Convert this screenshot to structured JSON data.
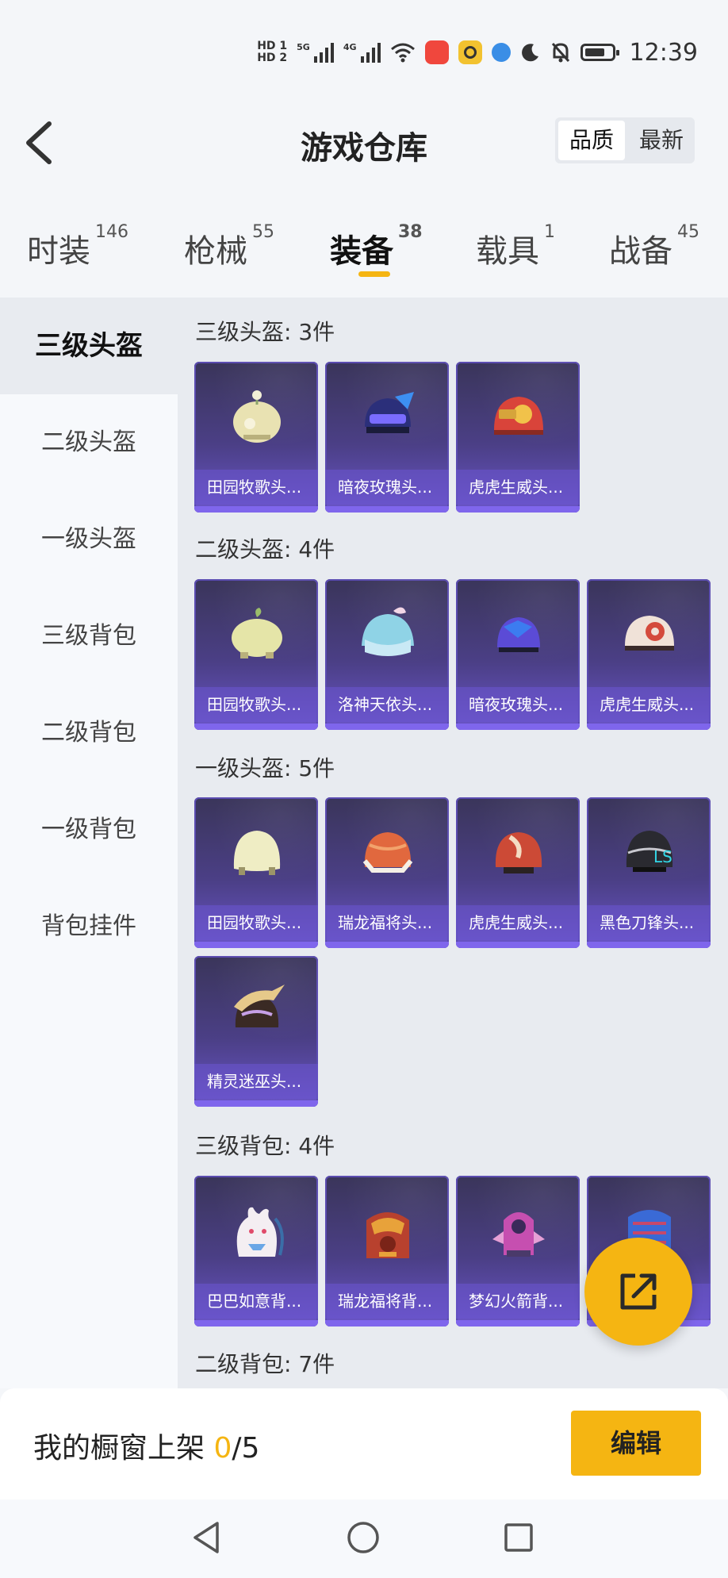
{
  "status": {
    "hd1": "HD 1",
    "hd2": "HD 2",
    "sig1_label": "5G",
    "sig2_label": "4G",
    "time": "12:39",
    "icons": [
      "wifi-icon",
      "app-red-icon",
      "app-yellow-icon",
      "app-blue-icon",
      "moon-icon",
      "bell-off-icon",
      "battery-icon"
    ]
  },
  "header": {
    "title": "游戏仓库",
    "sort_quality": "品质",
    "sort_latest": "最新"
  },
  "tabs": [
    {
      "label": "时装",
      "count": "146"
    },
    {
      "label": "枪械",
      "count": "55"
    },
    {
      "label": "装备",
      "count": "38"
    },
    {
      "label": "载具",
      "count": "1"
    },
    {
      "label": "战备",
      "count": "45"
    }
  ],
  "sidebar": [
    {
      "label": "三级头盔"
    },
    {
      "label": "二级头盔"
    },
    {
      "label": "一级头盔"
    },
    {
      "label": "三级背包"
    },
    {
      "label": "二级背包"
    },
    {
      "label": "一级背包"
    },
    {
      "label": "背包挂件"
    }
  ],
  "sections": [
    {
      "title": "三级头盔: 3件",
      "items": [
        "田园牧歌头...",
        "暗夜玫瑰头...",
        "虎虎生威头..."
      ]
    },
    {
      "title": "二级头盔: 4件",
      "items": [
        "田园牧歌头...",
        "洛神天依头...",
        "暗夜玫瑰头...",
        "虎虎生威头..."
      ]
    },
    {
      "title": "一级头盔: 5件",
      "items": [
        "田园牧歌头...",
        "瑞龙福将头...",
        "虎虎生威头...",
        "黑色刀锋头...",
        "精灵迷巫头..."
      ]
    },
    {
      "title": "三级背包: 4件",
      "items": [
        "巴巴如意背...",
        "瑞龙福将背...",
        "梦幻火箭背...",
        ""
      ]
    },
    {
      "title": "二级背包: 7件"
    }
  ],
  "bottom": {
    "shelf_label": "我的橱窗上架",
    "shelf_count": "0",
    "shelf_total": "/5",
    "edit_label": "编辑"
  },
  "colors": {
    "accent": "#f5b512",
    "card_purple": "#4b3f86",
    "background": "#f4f6f9"
  }
}
